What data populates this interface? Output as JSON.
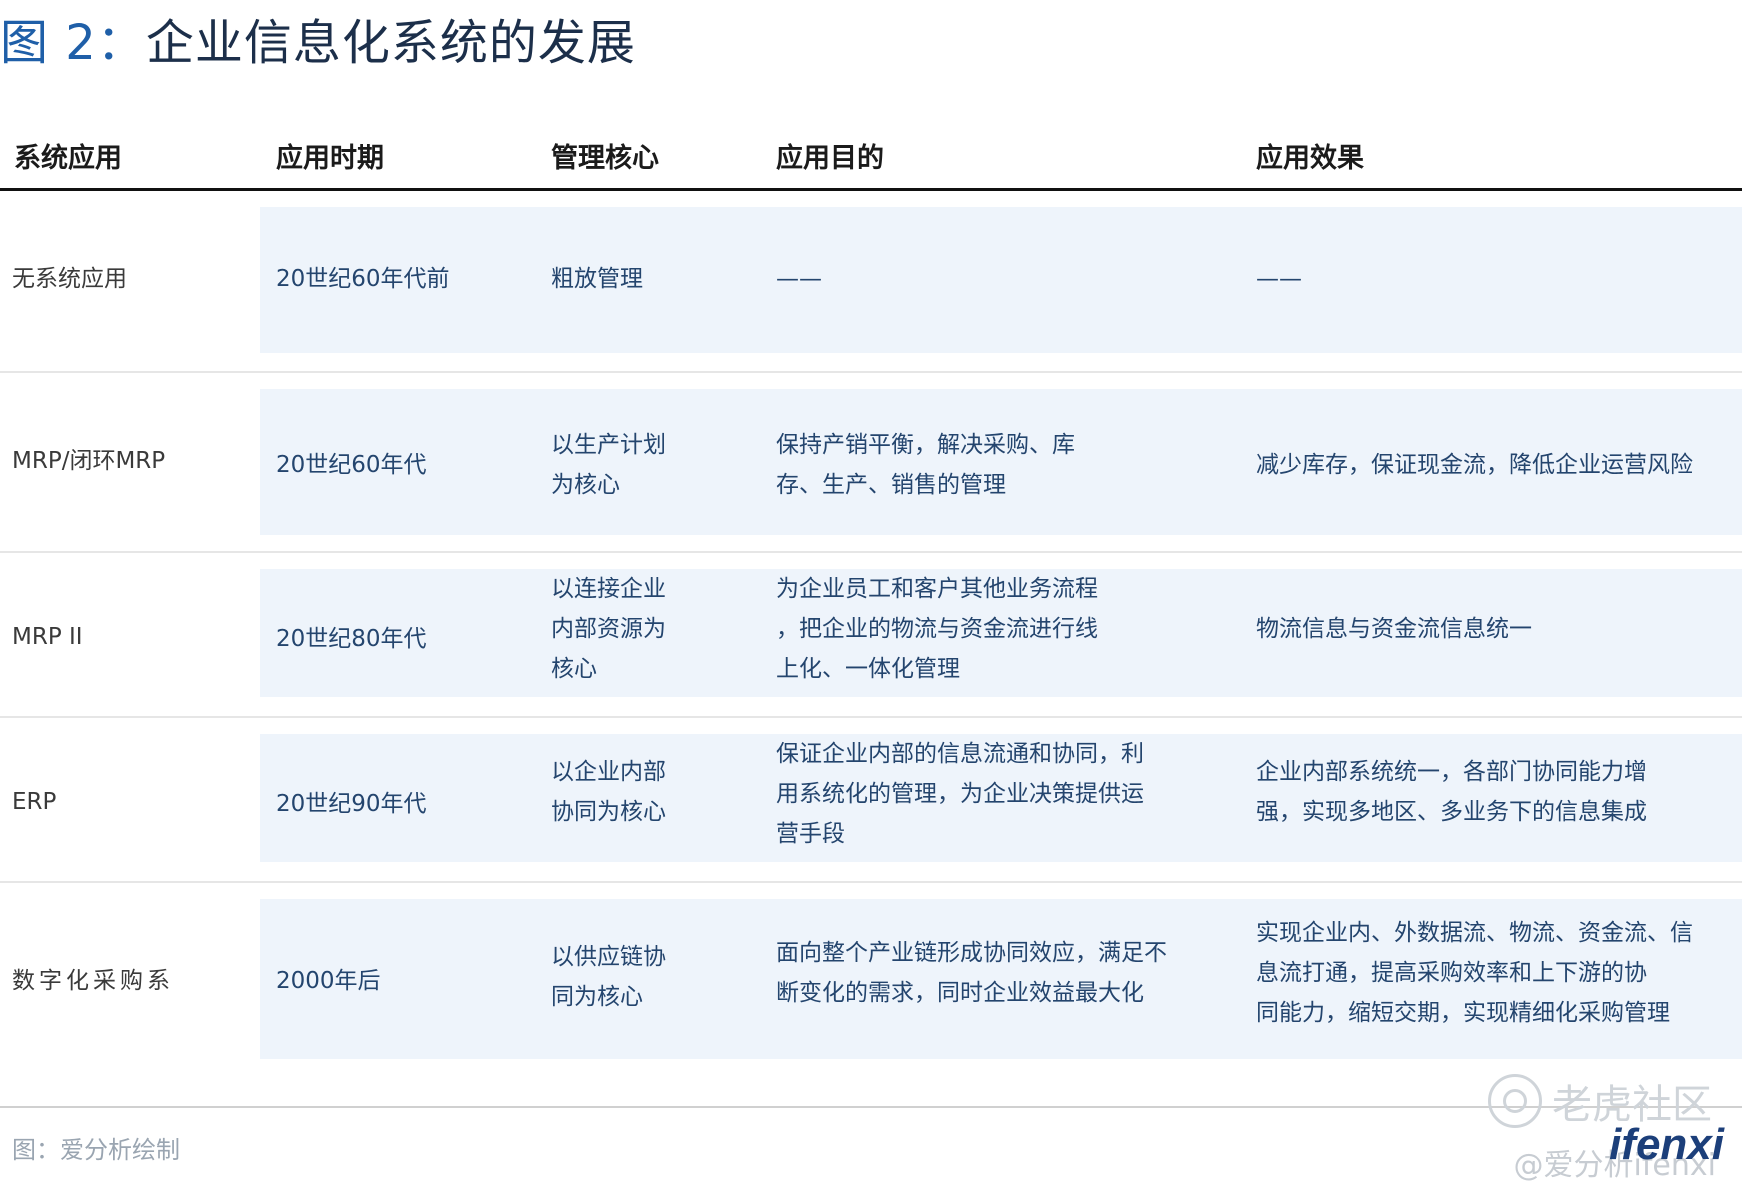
{
  "title": {
    "figure": "图 2：",
    "text": "企业信息化系统的发展"
  },
  "headers": {
    "system": "系统应用",
    "period": "应用时期",
    "core": "管理核心",
    "goal": "应用目的",
    "effect": "应用效果"
  },
  "rows": [
    {
      "system": "无系统应用",
      "period": "20世纪60年代前",
      "core": [
        "粗放管理"
      ],
      "goal": [
        "——"
      ],
      "effect": [
        "——"
      ]
    },
    {
      "system": "MRP/闭环MRP",
      "period": "20世纪60年代",
      "core": [
        "以生产计划",
        "为核心"
      ],
      "goal": [
        "保持产销平衡，解决采购、库",
        "存、生产、销售的管理"
      ],
      "effect": [
        "减少库存，保证现金流，降低企业运营风险"
      ]
    },
    {
      "system": "MRP II",
      "period": "20世纪80年代",
      "core": [
        "以连接企业",
        "内部资源为",
        "核心"
      ],
      "goal": [
        "为企业员工和客户其他业务流程",
        "，把企业的物流与资金流进行线",
        "上化、一体化管理"
      ],
      "effect": [
        "物流信息与资金流信息统一"
      ]
    },
    {
      "system": "ERP",
      "period": "20世纪90年代",
      "core": [
        "以企业内部",
        "协同为核心"
      ],
      "goal": [
        "保证企业内部的信息流通和协同，利",
        "用系统化的管理，为企业决策提供运",
        "营手段"
      ],
      "effect": [
        "企业内部系统统一，各部门协同能力增",
        "强，实现多地区、多业务下的信息集成"
      ]
    },
    {
      "system": "数字化采购系",
      "period": "2000年后",
      "core": [
        "以供应链协",
        "同为核心"
      ],
      "goal": [
        "面向整个产业链形成协同效应，满足不",
        "断变化的需求，同时企业效益最大化"
      ],
      "effect": [
        "实现企业内、外数据流、物流、资金流、信",
        "息流打通，提高采购效率和上下游的协",
        "同能力，缩短交期，实现精细化采购管理"
      ]
    }
  ],
  "source": "图：爱分析绘制",
  "watermark": "老虎社区",
  "handle": "@爱分析ifenxi",
  "logo": "ifenxi",
  "icons": {
    "watermark": "tiger-community-logo-icon"
  }
}
